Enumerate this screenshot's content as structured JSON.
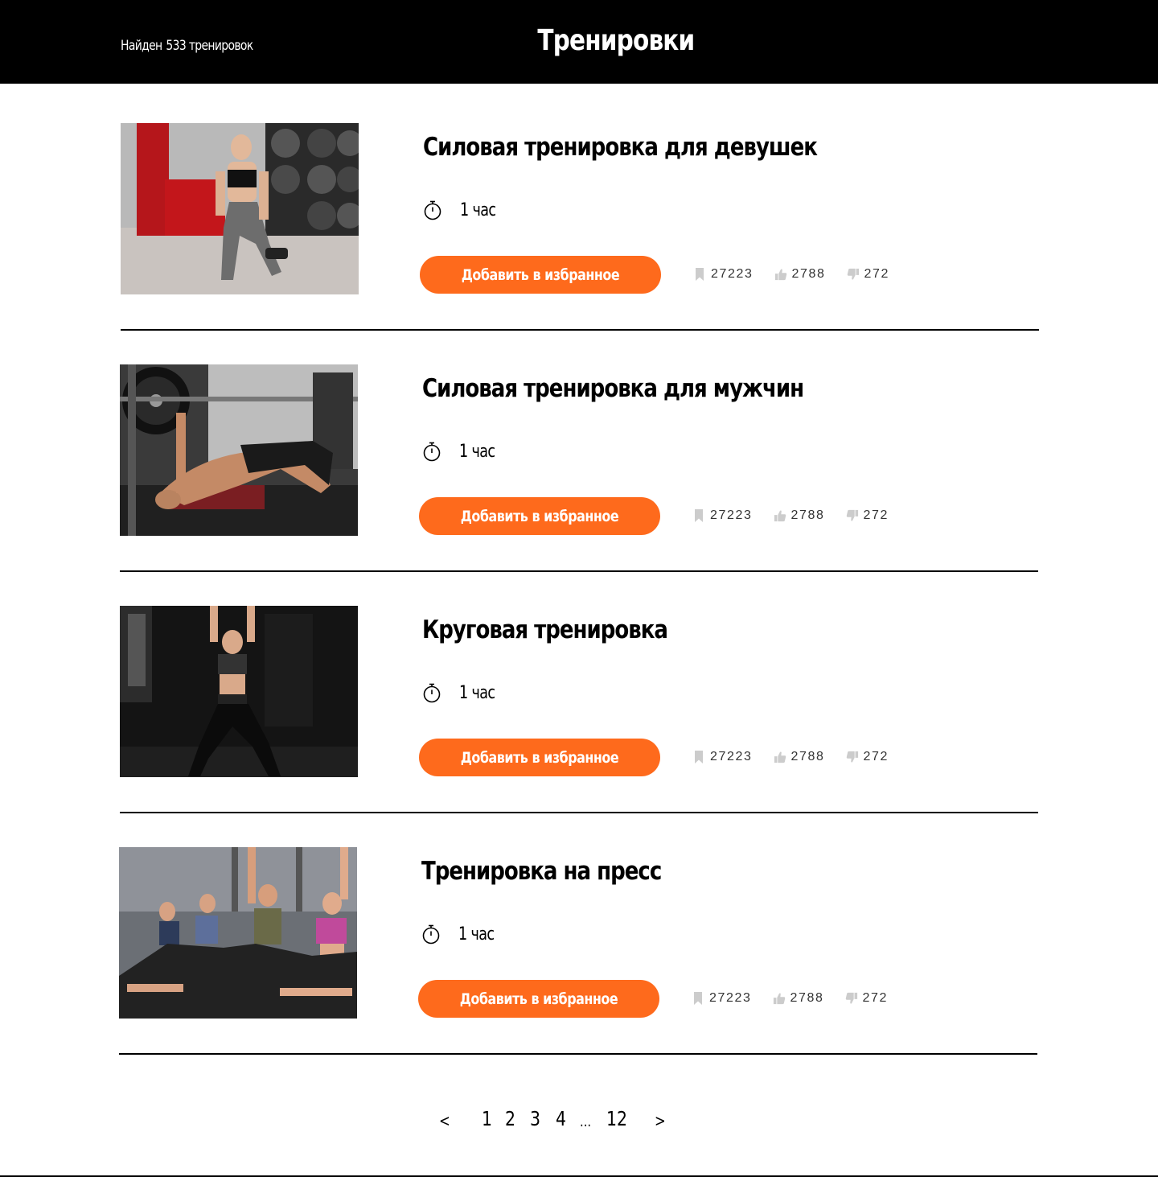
{
  "header": {
    "found_label": "Найден",
    "found_count": "533 тренировок",
    "title": "Тренировки"
  },
  "workouts": [
    {
      "title": "Силовая тренировка для девушек",
      "duration": "1 час",
      "button_label": "Добавить в избранное",
      "bookmarks": "27223",
      "likes": "2788",
      "dislikes": "272",
      "image": "woman-lunge-gym-photo"
    },
    {
      "title": "Силовая тренировка для мужчин",
      "duration": "1 час",
      "button_label": "Добавить в избранное",
      "bookmarks": "27223",
      "likes": "2788",
      "dislikes": "272",
      "image": "man-bench-press-photo"
    },
    {
      "title": "Круговая тренировка",
      "duration": "1 час",
      "button_label": "Добавить в избранное",
      "bookmarks": "27223",
      "likes": "2788",
      "dislikes": "272",
      "image": "woman-kettlebell-dark-gym-photo"
    },
    {
      "title": "Тренировка на пресс",
      "duration": "1 час",
      "button_label": "Добавить в избранное",
      "bookmarks": "27223",
      "likes": "2788",
      "dislikes": "272",
      "image": "group-ab-workout-photo"
    }
  ],
  "pagination": {
    "prev": "<",
    "pages": [
      "1",
      "2",
      "3",
      "4"
    ],
    "ellipsis": "...",
    "last": "12",
    "next": ">"
  },
  "colors": {
    "header_bg": "#000000",
    "accent": "#fe6a1c",
    "icon_gray": "#cccccc"
  },
  "icons": {
    "timer": "stopwatch-icon",
    "bookmark": "bookmark-icon",
    "like": "thumbs-up-icon",
    "dislike": "thumbs-down-icon"
  }
}
